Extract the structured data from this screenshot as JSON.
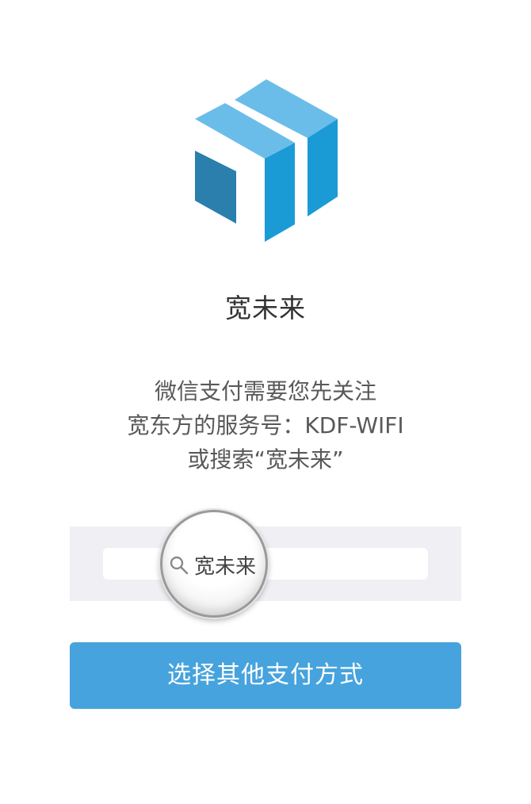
{
  "app": {
    "name": "宽未来",
    "brand_colors": {
      "logo_light": "#66baea",
      "logo_mid": "#1b9bd6",
      "logo_dark": "#2a7fad",
      "button": "#46a3dd"
    }
  },
  "instructions": {
    "line1": "微信支付需要您先关注",
    "line2": "宽东方的服务号：KDF-WIFI",
    "line3": "或搜索“宽未来”"
  },
  "search": {
    "icon": "search-icon",
    "text": "宽未来"
  },
  "button": {
    "label": "选择其他支付方式"
  }
}
